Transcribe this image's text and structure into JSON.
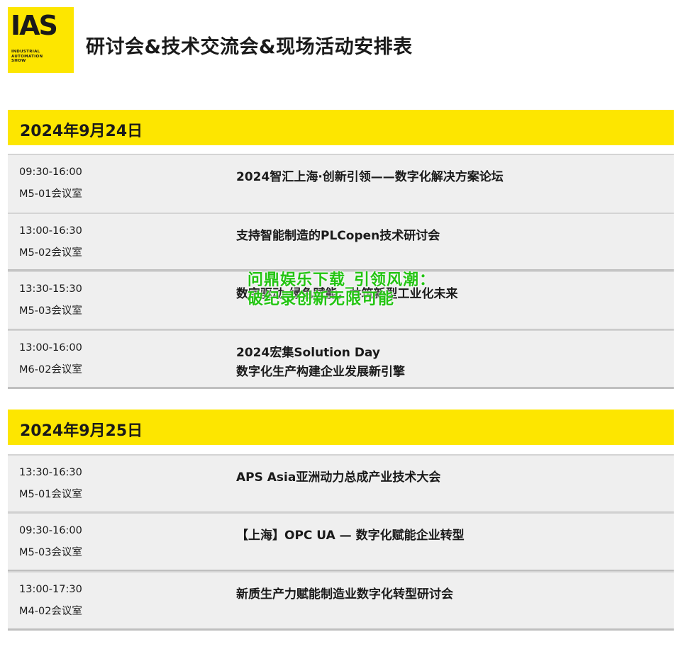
{
  "logo": {
    "mark": "IAS",
    "lines": [
      "INDUSTRIAL",
      "AUTOMATION",
      "SHOW"
    ]
  },
  "page_title": "研讨会&技术交流会&现场活动安排表",
  "days": [
    {
      "date": "2024年9月24日",
      "sessions": [
        {
          "time": "09:30-16:00",
          "room": "M5-01会议室",
          "title": "2024智汇上海·创新引领——数字化解决方案论坛",
          "title2": ""
        },
        {
          "time": "13:00-16:30",
          "room": "M5-02会议室",
          "title": "支持智能制造的PLCopen技术研讨会",
          "title2": ""
        },
        {
          "time": "13:30-15:30",
          "room": "M5-03会议室",
          "title": "数字驱动·绿色赋能，共筑新型工业化未来",
          "title2": ""
        },
        {
          "time": "13:00-16:00",
          "room": "M6-02会议室",
          "title": "2024宏集Solution Day",
          "title2": "数字化生产构建企业发展新引擎"
        }
      ]
    },
    {
      "date": "2024年9月25日",
      "sessions": [
        {
          "time": "13:30-16:30",
          "room": "M5-01会议室",
          "title": "APS Asia亚洲动力总成产业技术大会",
          "title2": ""
        },
        {
          "time": "09:30-16:00",
          "room": "M5-03会议室",
          "title": "【上海】OPC UA — 数字化赋能企业转型",
          "title2": ""
        },
        {
          "time": "13:00-17:30",
          "room": "M4-02会议室",
          "title": "新质生产力赋能制造业数字化转型研讨会",
          "title2": ""
        }
      ]
    }
  ],
  "overlay_text": "问鼎娱乐下载_引领风潮：破纪录创新无限可能",
  "colors": {
    "accent": "#fde600",
    "row_bg": "#efefef",
    "overlay": "#22c411"
  }
}
